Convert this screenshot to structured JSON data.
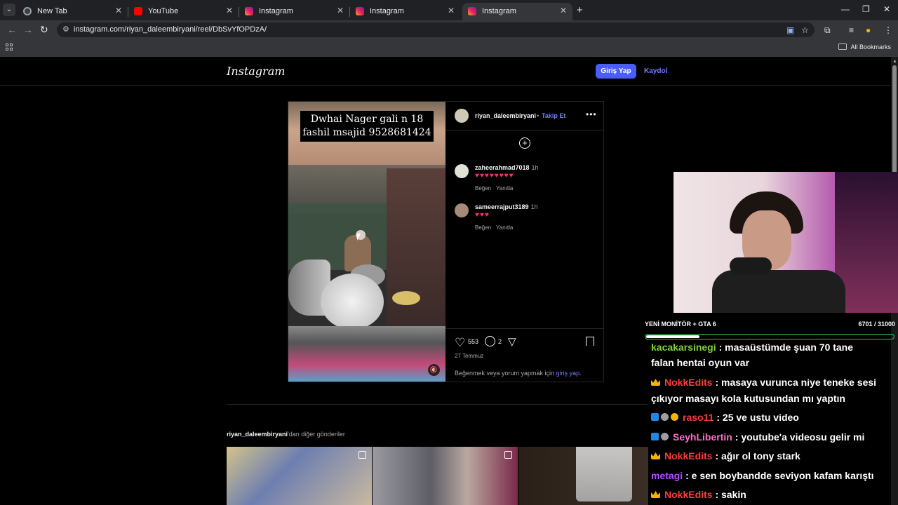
{
  "browser": {
    "tabs": [
      {
        "label": "New Tab",
        "icon": "google-icon"
      },
      {
        "label": "YouTube",
        "icon": "youtube-icon"
      },
      {
        "label": "Instagram",
        "icon": "instagram-icon"
      },
      {
        "label": "Instagram",
        "icon": "instagram-icon"
      },
      {
        "label": "Instagram",
        "icon": "instagram-icon",
        "active": true
      }
    ],
    "url": "instagram.com/riyan_daleembiryani/reel/DbSvYfOPDzA/",
    "bookmarks_label": "All Bookmarks"
  },
  "instagram": {
    "logo": "Instagram",
    "login_label": "Giriş Yap",
    "signup_label": "Kaydol",
    "post": {
      "caption_overlay": "Dwhai Nager gali n 18 fashil msajid 9528681424",
      "author": "riyan_daleembiryani",
      "dot": "•",
      "follow_label": "Takip Et",
      "comments": [
        {
          "user": "zaheerahmad7018",
          "time": "1h",
          "text": "♥♥♥♥♥♥♥♥",
          "like_label": "Beğen",
          "reply_label": "Yanıtla"
        },
        {
          "user": "sameerrajput3189",
          "time": "1h",
          "text": "♥♥♥",
          "like_label": "Beğen",
          "reply_label": "Yanıtla"
        }
      ],
      "likes": "553",
      "comment_count": "2",
      "date": "27 Temmuz",
      "login_prompt_prefix": "Beğenmek veya yorum yapmak için ",
      "login_prompt_link": "giriş yap",
      "login_prompt_suffix": "."
    },
    "more_posts_user": "riyan_daleembiryani",
    "more_posts_suffix": "'dan diğer gönderiler"
  },
  "stream": {
    "goal_title": "YENİ MONİTÖR + GTA 6",
    "goal_count": "6701 / 31000",
    "goal_progress": 0.216,
    "chat": [
      {
        "user": "kacakarsinegi",
        "user_color": "#7fd13b",
        "text": ": masaüstümde şuan 70 tane",
        "badges": []
      },
      {
        "user": "",
        "user_color": "#ffffff",
        "text": "falan hentai oyun var",
        "badges": []
      },
      {
        "user": "NokkEdits",
        "user_color": "#ff3b3b",
        "text": ": masaya vurunca niye teneke sesi",
        "badges": [
          "crown"
        ]
      },
      {
        "user": "",
        "user_color": "#ffffff",
        "text": "çıkıyor masayı kola kutusundan mı yaptın",
        "badges": []
      },
      {
        "user": "raso11",
        "user_color": "#ff3b3b",
        "text": ": 25 ve ustu video",
        "badges": [
          "cube",
          "gear",
          "coin"
        ]
      },
      {
        "user": "SeyhLibertin",
        "user_color": "#ff6ec7",
        "text": ": youtube'a videosu gelir mi",
        "badges": [
          "cube",
          "gear"
        ]
      },
      {
        "user": "NokkEdits",
        "user_color": "#ff3b3b",
        "text": ": ağır ol tony stark",
        "badges": [
          "crown"
        ]
      },
      {
        "user": "metagi",
        "user_color": "#b04cff",
        "text": ": e sen boybandde seviyon kafam karıştı",
        "badges": []
      },
      {
        "user": "NokkEdits",
        "user_color": "#ff3b3b",
        "text": ": sakin",
        "badges": [
          "crown"
        ]
      }
    ]
  }
}
